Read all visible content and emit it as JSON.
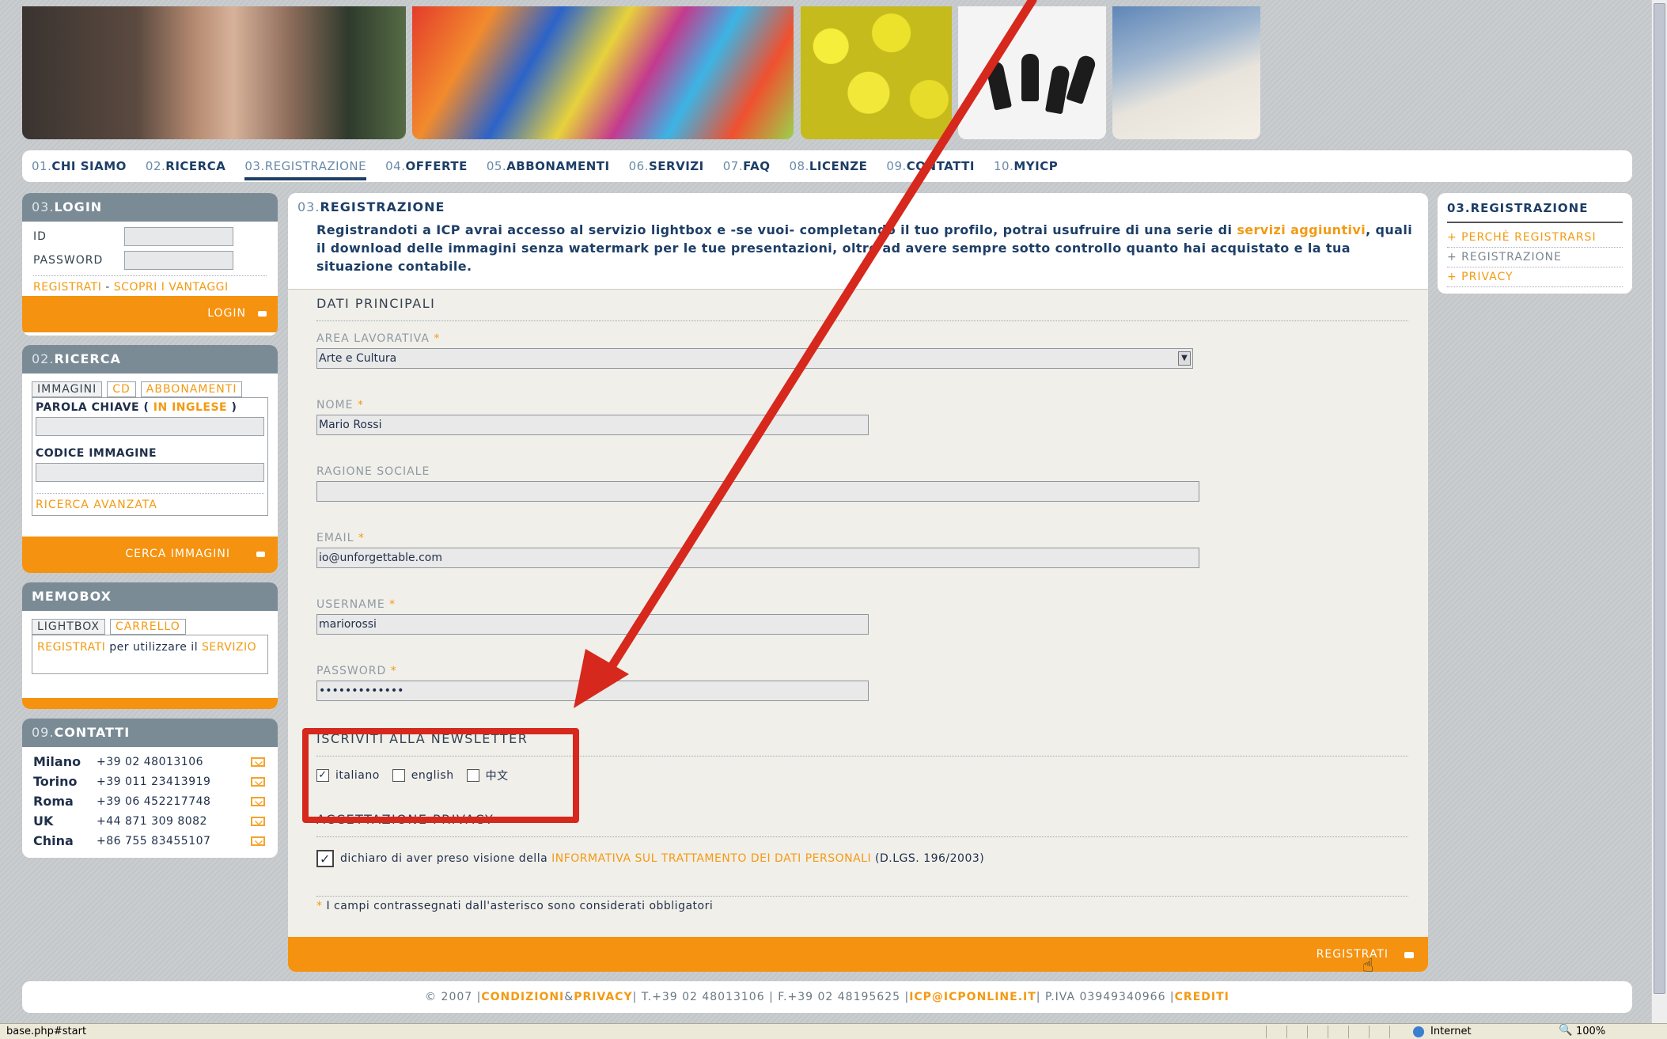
{
  "nav": {
    "items": [
      {
        "num": "01.",
        "label": "CHI SIAMO"
      },
      {
        "num": "02.",
        "label": "RICERCA"
      },
      {
        "num": "03.",
        "label": "REGISTRAZIONE"
      },
      {
        "num": "04.",
        "label": "OFFERTE"
      },
      {
        "num": "05.",
        "label": "ABBONAMENTI"
      },
      {
        "num": "06.",
        "label": "SERVIZI"
      },
      {
        "num": "07.",
        "label": "FAQ"
      },
      {
        "num": "08.",
        "label": "LICENZE"
      },
      {
        "num": "09.",
        "label": "CONTATTI"
      },
      {
        "num": "10.",
        "label": "MYICP"
      }
    ],
    "active": "REGISTRAZIONE"
  },
  "login": {
    "num": "03.",
    "title": "LOGIN",
    "id_label": "ID",
    "password_label": "PASSWORD",
    "register_link": "REGISTRATI",
    "separator": " - ",
    "discover_link": "SCOPRI I VANTAGGI",
    "button": "LOGIN"
  },
  "search": {
    "num": "02.",
    "title": "RICERCA",
    "tabs": [
      "IMMAGINI",
      "CD",
      "ABBONAMENTI"
    ],
    "keyword_label_prefix": "PAROLA CHIAVE (",
    "keyword_label_hint": "IN INGLESE",
    "keyword_label_suffix": ")",
    "code_label": "CODICE IMMAGINE",
    "advanced_link": "RICERCA AVANZATA",
    "button": "CERCA IMMAGINI"
  },
  "memobox": {
    "title": "MEMOBOX",
    "tabs": [
      "LIGHTBOX",
      "CARRELLO"
    ],
    "register_link": "REGISTRATI",
    "text": " per utilizzare il ",
    "service_link": "SERVIZIO"
  },
  "contacts": {
    "num": "09.",
    "title": "CONTATTI",
    "rows": [
      {
        "city": "Milano",
        "phone": "+39 02 48013106"
      },
      {
        "city": "Torino",
        "phone": "+39 011 23413919"
      },
      {
        "city": "Roma",
        "phone": "+39 06 452217748"
      },
      {
        "city": "UK",
        "phone": "+44 871 309 8082"
      },
      {
        "city": "China",
        "phone": "+86 755 83455107"
      }
    ]
  },
  "main": {
    "num": "03.",
    "title": "REGISTRAZIONE",
    "intro_1": "Registrandoti a ICP avrai accesso al servizio lightbox e -se vuoi- completando il tuo profilo, potrai usufruire di una serie di ",
    "intro_link": "servizi aggiuntivi",
    "intro_2": ", quali il download delle immagini senza watermark per le tue presentazioni, oltre ad avere sempre sotto controllo quanto hai acquistato e la tua situazione contabile.",
    "section_main": "DATI PRINCIPALI",
    "fields": {
      "area_label": "AREA LAVORATIVA",
      "area_value": "Arte e Cultura",
      "name_label": "NOME",
      "name_value": "Mario Rossi",
      "company_label": "RAGIONE SOCIALE",
      "company_value": "",
      "email_label": "EMAIL",
      "email_value": "io@unforgettable.com",
      "username_label": "USERNAME",
      "username_value": "mariorossi",
      "password_label": "PASSWORD",
      "password_value": "•••••••••••••"
    },
    "required_mark": "*",
    "section_newsletter": "ISCRIVITI ALLA NEWSLETTER",
    "newsletter_options": [
      {
        "label": "italiano",
        "checked": true
      },
      {
        "label": "english",
        "checked": false
      },
      {
        "label": "中文",
        "checked": false
      }
    ],
    "section_privacy": "ACCETTAZIONE PRIVACY",
    "privacy_text_1": "dichiaro di aver preso visione della ",
    "privacy_link": "INFORMATIVA SUL TRATTAMENTO DEI DATI PERSONALI",
    "privacy_text_2": " (D.LGS. 196/2003)",
    "required_note_mark": "*",
    "required_note": " I campi contrassegnati dall'asterisco sono considerati obbligatori",
    "submit": "REGISTRATI"
  },
  "right": {
    "num": "03.",
    "title": "REGISTRAZIONE",
    "links": [
      {
        "label": "+ PERCHÈ REGISTRARSI",
        "style": "orange"
      },
      {
        "label": "+ REGISTRAZIONE",
        "style": "gray"
      },
      {
        "label": "+ PRIVACY",
        "style": "orange"
      }
    ]
  },
  "footer": {
    "copyright": "© 2007 | ",
    "conditions": "CONDIZIONI",
    "amp": " & ",
    "privacy": "PRIVACY",
    "contacts": " | T.+39 02 48013106 | F.+39 02 48195625 | ",
    "email": "ICP@ICPONLINE.IT",
    "vat": " | P.IVA 03949340966 | ",
    "credits": "CREDITI"
  },
  "status": {
    "url": "base.php#start",
    "zone": "Internet",
    "zoom": "100%"
  },
  "colors": {
    "accent": "#f5920f",
    "navy": "#1d3e66",
    "annotation": "#d6281c"
  }
}
